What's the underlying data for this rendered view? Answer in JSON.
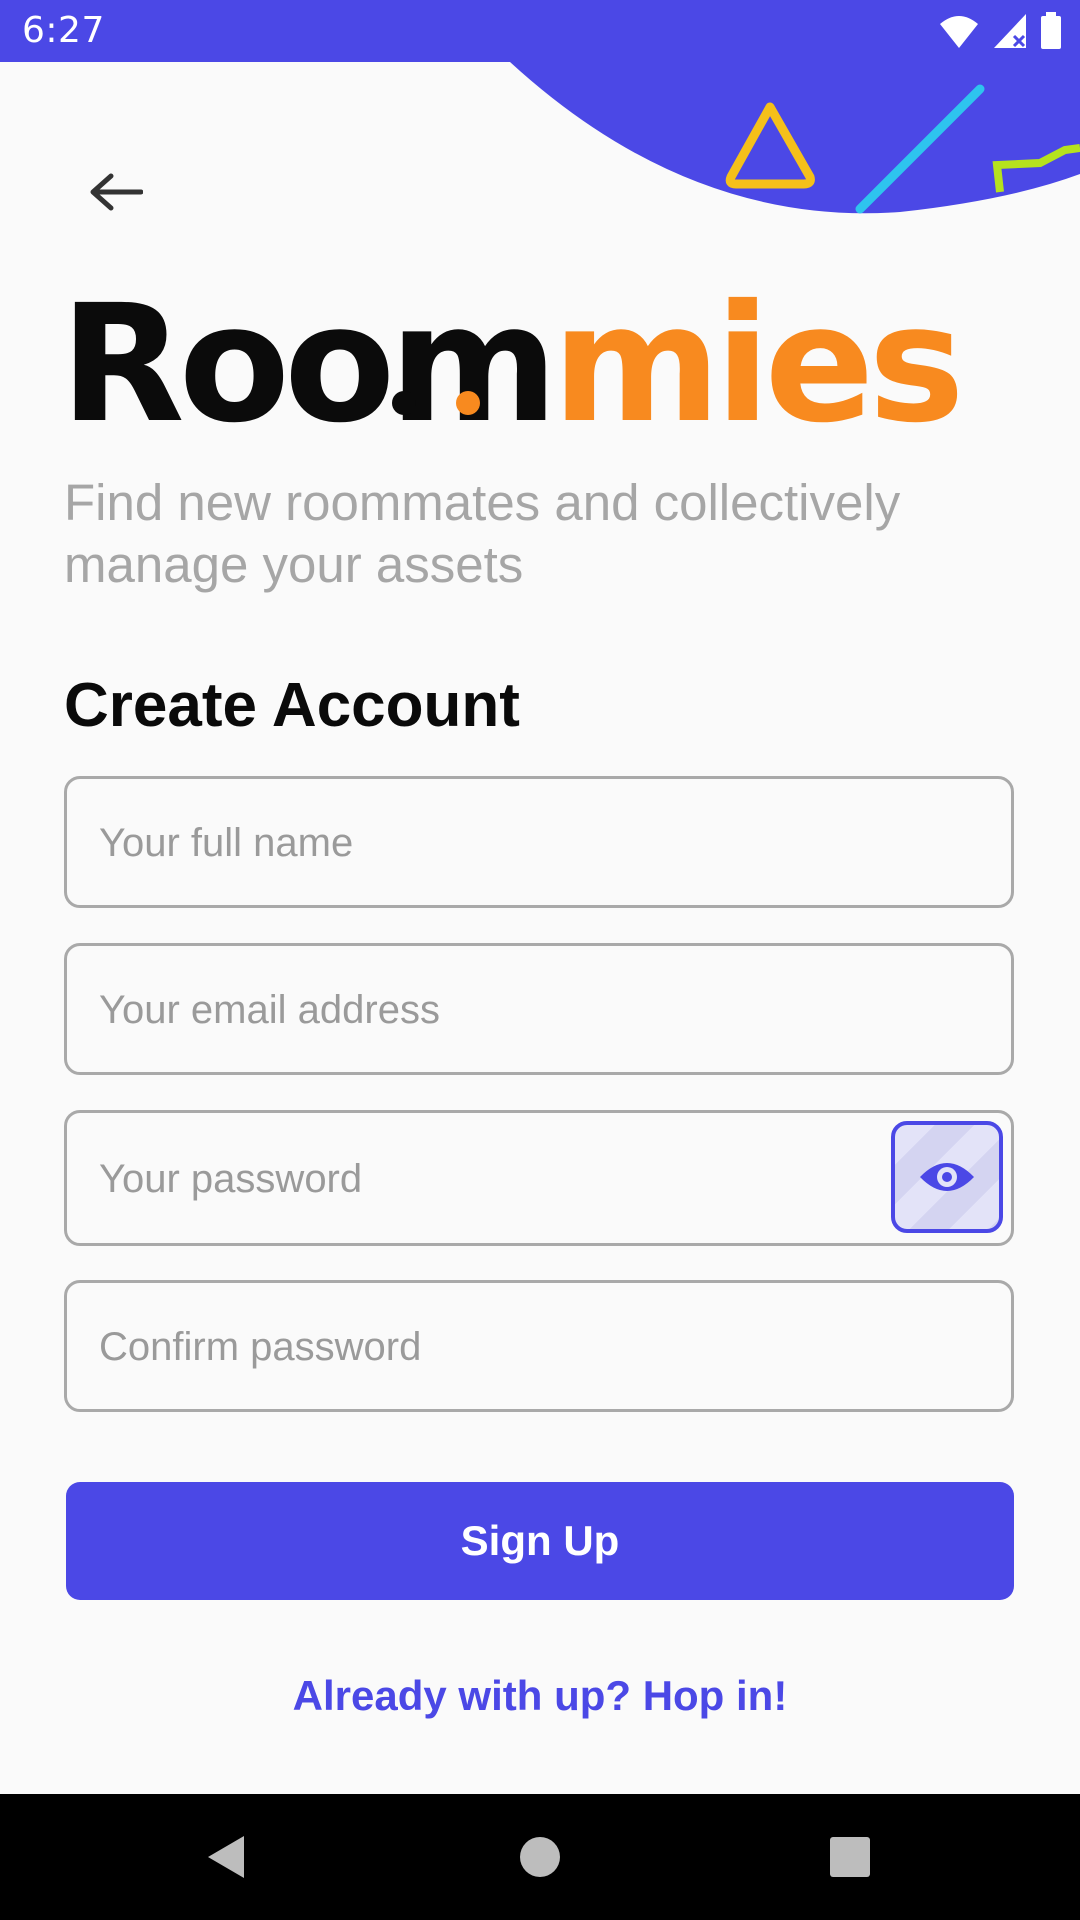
{
  "status_bar": {
    "time": "6:27",
    "icons": [
      "wifi-icon",
      "signal-icon",
      "battery-icon"
    ]
  },
  "header": {
    "back_icon": "arrow-left-icon"
  },
  "logo": {
    "part1": "Room",
    "part2": "mies",
    "colors": {
      "dark": "#0b0b0b",
      "accent": "#f88a1f"
    }
  },
  "tagline": "Find new roommates and collectively manage your assets",
  "form": {
    "title": "Create Account",
    "full_name": {
      "placeholder": "Your full name",
      "value": ""
    },
    "email": {
      "placeholder": "Your email address",
      "value": ""
    },
    "password": {
      "placeholder": "Your password",
      "value": "",
      "toggle_icon": "eye-icon"
    },
    "confirm_password": {
      "placeholder": "Confirm password",
      "value": ""
    },
    "submit_label": "Sign Up",
    "login_link": "Already with up? Hop in!"
  },
  "colors": {
    "primary": "#4b48e6",
    "background": "#fafafa"
  },
  "nav_bar": {
    "icons": [
      "back-triangle-icon",
      "home-circle-icon",
      "recents-square-icon"
    ]
  }
}
